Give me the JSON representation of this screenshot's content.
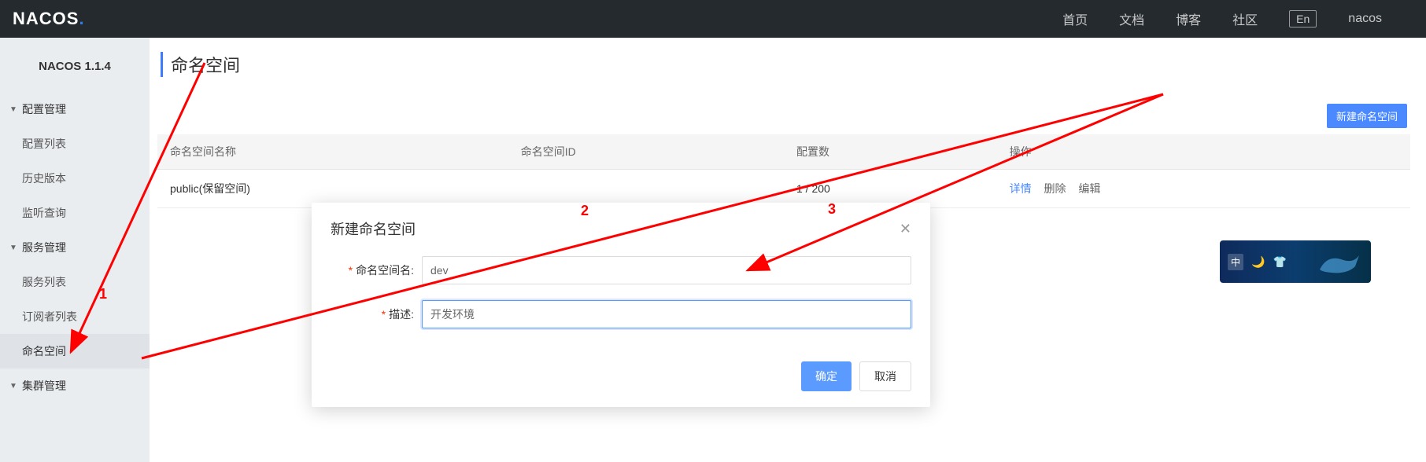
{
  "navbar": {
    "logo_main": "NACOS",
    "logo_dot": ".",
    "links": [
      "首页",
      "文档",
      "博客",
      "社区"
    ],
    "lang": "En",
    "user": "nacos"
  },
  "sidebar": {
    "version": "NACOS 1.1.4",
    "groups": [
      {
        "label": "配置管理",
        "items": [
          "配置列表",
          "历史版本",
          "监听查询"
        ]
      },
      {
        "label": "服务管理",
        "items": [
          "服务列表",
          "订阅者列表"
        ]
      }
    ],
    "standalone": {
      "namespace": "命名空间",
      "cluster": "集群管理"
    }
  },
  "page": {
    "title": "命名空间",
    "new_button": "新建命名空间"
  },
  "table": {
    "headers": [
      "命名空间名称",
      "命名空间ID",
      "配置数",
      "操作"
    ],
    "rows": [
      {
        "name": "public(保留空间)",
        "id": "",
        "count": "1 / 200",
        "actions": {
          "detail": "详情",
          "delete": "删除",
          "edit": "编辑"
        }
      }
    ]
  },
  "modal": {
    "title": "新建命名空间",
    "fields": {
      "name_label": "命名空间名:",
      "name_value": "dev",
      "desc_label": "描述:",
      "desc_value": "开发环境"
    },
    "ok": "确定",
    "cancel": "取消"
  },
  "promo": {
    "glyph": "中"
  },
  "annotations": {
    "n1": "1",
    "n2": "2",
    "n3": "3"
  }
}
